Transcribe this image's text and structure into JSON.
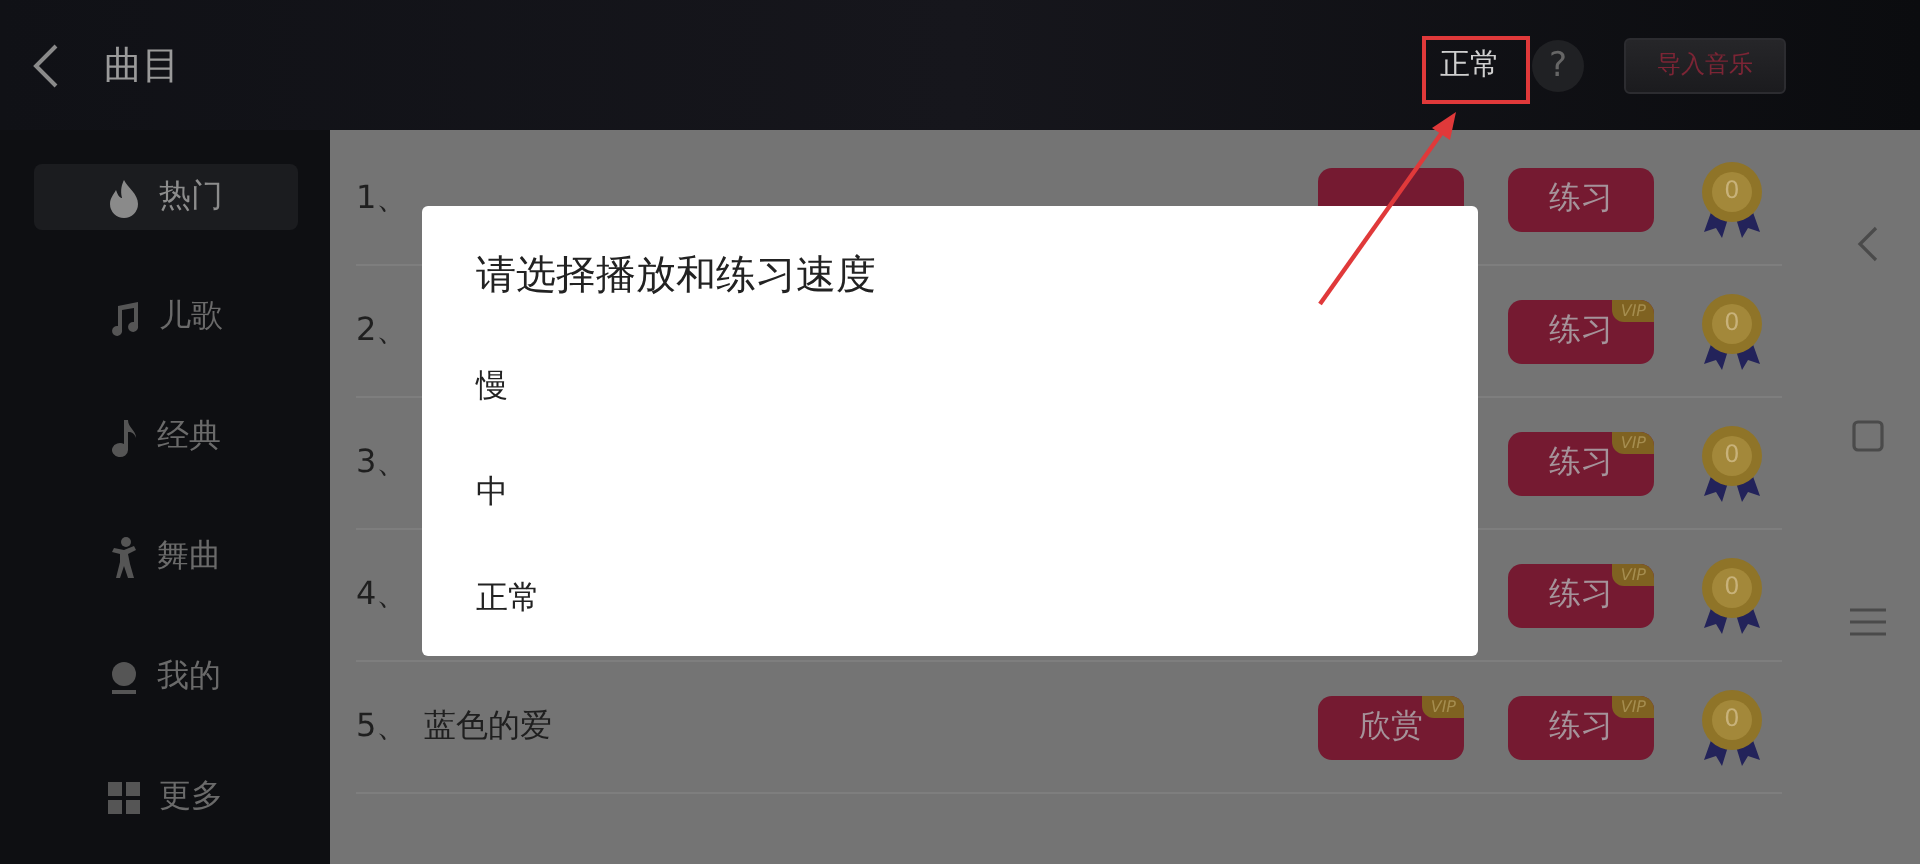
{
  "top_bar": {
    "title": "曲目",
    "speed": {
      "label": "正常",
      "highlighted": true
    },
    "help": "?",
    "import_button": "导入音乐"
  },
  "sidebar": {
    "items": [
      {
        "kind": "fire",
        "label": "热门",
        "selected": true
      },
      {
        "kind": "note",
        "label": "儿歌",
        "selected": false
      },
      {
        "kind": "eighth",
        "label": "经典",
        "selected": false
      },
      {
        "kind": "dancer",
        "label": "舞曲",
        "selected": false
      },
      {
        "kind": "person",
        "label": "我的",
        "selected": false
      },
      {
        "kind": "grid",
        "label": "更多",
        "selected": false
      }
    ]
  },
  "songs": [
    {
      "index": "1、",
      "appreciate": {
        "shown": true
      },
      "practice": {
        "label": "练习"
      },
      "medal": "0"
    },
    {
      "index": "2、",
      "practice": {
        "label": "练习",
        "badge": "VIP"
      },
      "medal": "0"
    },
    {
      "index": "3、",
      "practice": {
        "label": "练习",
        "badge": "VIP"
      },
      "medal": "0"
    },
    {
      "index": "4、",
      "practice": {
        "label": "练习",
        "badge": "VIP"
      },
      "medal": "0"
    },
    {
      "index": "5、",
      "title": "蓝色的爱",
      "appreciate": {
        "label": "欣赏",
        "badge": "VIP"
      },
      "practice": {
        "label": "练习",
        "badge": "VIP"
      },
      "medal": "0"
    }
  ],
  "dialog": {
    "title": "请选择播放和练习速度",
    "options": [
      "慢",
      "中",
      "正常"
    ]
  }
}
